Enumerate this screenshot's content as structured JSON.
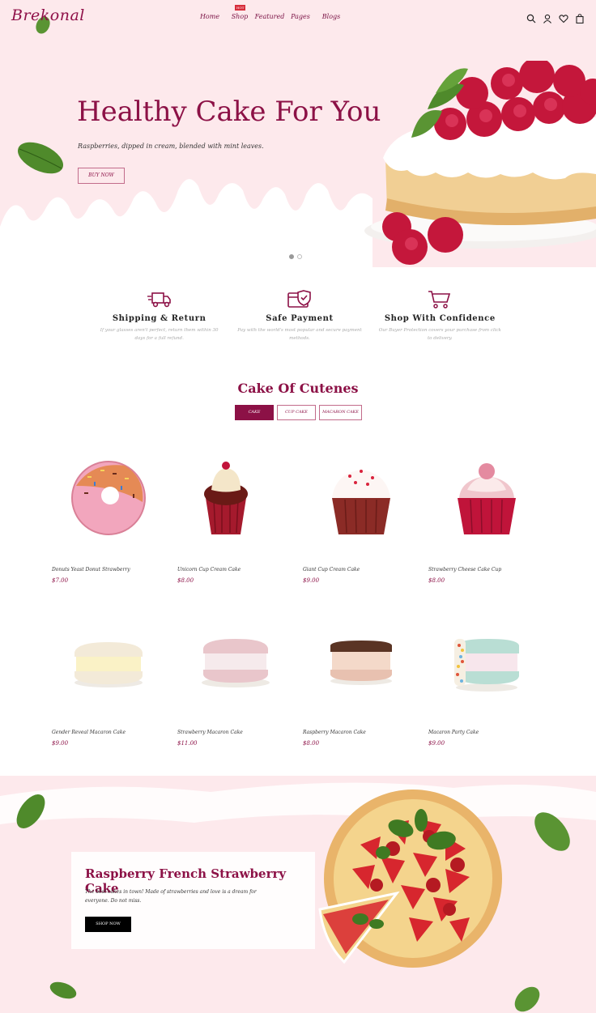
{
  "header": {
    "logo_text": "Brekonal",
    "nav": [
      {
        "label": "Home"
      },
      {
        "label": "Shop",
        "badge": "HOT"
      },
      {
        "label": "Featured"
      },
      {
        "label": "Pages"
      },
      {
        "label": "Blogs"
      }
    ],
    "icons": [
      "search-icon",
      "user-icon",
      "heart-icon",
      "bag-icon"
    ]
  },
  "hero": {
    "title": "Healthy Cake For You",
    "subtitle": "Raspberries, dipped in cream, blended with mint leaves.",
    "button_label": "BUY NOW",
    "slides_total": 2,
    "active_slide": 1
  },
  "features": [
    {
      "icon": "truck-icon",
      "title": "Shipping & Return",
      "text": "If your glasses aren't perfect, return them within 30 days for a full refund."
    },
    {
      "icon": "shield-card-icon",
      "title": "Safe Payment",
      "text": "Pay with the world's most popular and secure payment methods."
    },
    {
      "icon": "cart-icon",
      "title": "Shop With Confidence",
      "text": "Our Buyer Protection covers your purchase from click to delivery."
    }
  ],
  "products_section": {
    "title": "Cake Of Cutenes",
    "tabs": [
      {
        "label": "CAKE",
        "active": true
      },
      {
        "label": "CUP CAKE",
        "active": false
      },
      {
        "label": "MACARON CAKE",
        "active": false
      }
    ],
    "products": [
      {
        "name": "Donuts Yeast Donut Strawberry",
        "price": "$7.00",
        "kind": "donut"
      },
      {
        "name": "Unicorn Cup Cream Cake",
        "price": "$8.00",
        "kind": "cupcake-dark"
      },
      {
        "name": "Giant Cup Cream Cake",
        "price": "$9.00",
        "kind": "cupcake-cream"
      },
      {
        "name": "Strawberry Cheese Cake Cup",
        "price": "$8.00",
        "kind": "cupcake-pink"
      },
      {
        "name": "Gender Reveal Macaron Cake",
        "price": "$9.00",
        "kind": "macaron-yellow"
      },
      {
        "name": "Strawberry Macaron Cake",
        "price": "$11.00",
        "kind": "macaron-pink"
      },
      {
        "name": "Raspberry Macaron Cake",
        "price": "$8.00",
        "kind": "macaron-choco"
      },
      {
        "name": "Macaron Party Cake",
        "price": "$9.00",
        "kind": "macaron-sprinkle"
      }
    ]
  },
  "banner": {
    "title": "Raspberry French Strawberry Cake",
    "text": "The best cakes in town! Made of strawberries and love is a dream for everyone. Do not miss.",
    "button_label": "SHOP NOW"
  },
  "colors": {
    "primary": "#8c1146",
    "pink_bg": "#fde9ec",
    "black": "#000000"
  }
}
